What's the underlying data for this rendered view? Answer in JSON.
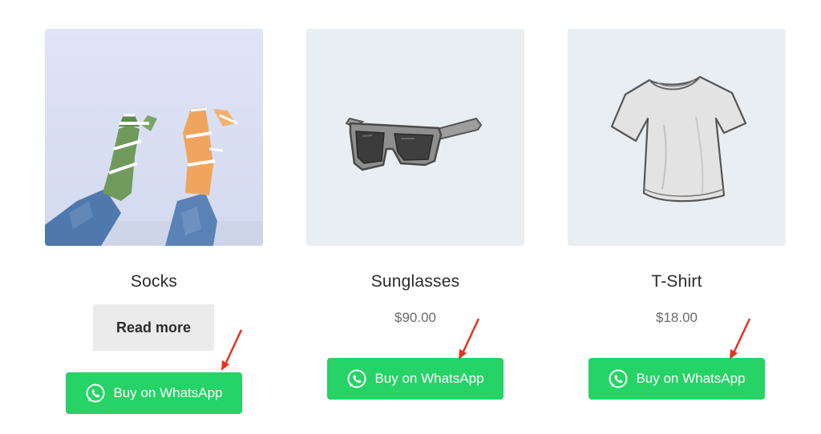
{
  "accent_color": "#25d366",
  "annotation_color": "#e8321e",
  "products": [
    {
      "name": "Socks",
      "price": "",
      "secondary_button_label": "Read more",
      "whatsapp_label": "Buy on WhatsApp",
      "image_icon": "socks-photo"
    },
    {
      "name": "Sunglasses",
      "price": "$90.00",
      "whatsapp_label": "Buy on WhatsApp",
      "image_icon": "sunglasses-icon"
    },
    {
      "name": "T-Shirt",
      "price": "$18.00",
      "whatsapp_label": "Buy on WhatsApp",
      "image_icon": "t-shirt-icon"
    }
  ]
}
